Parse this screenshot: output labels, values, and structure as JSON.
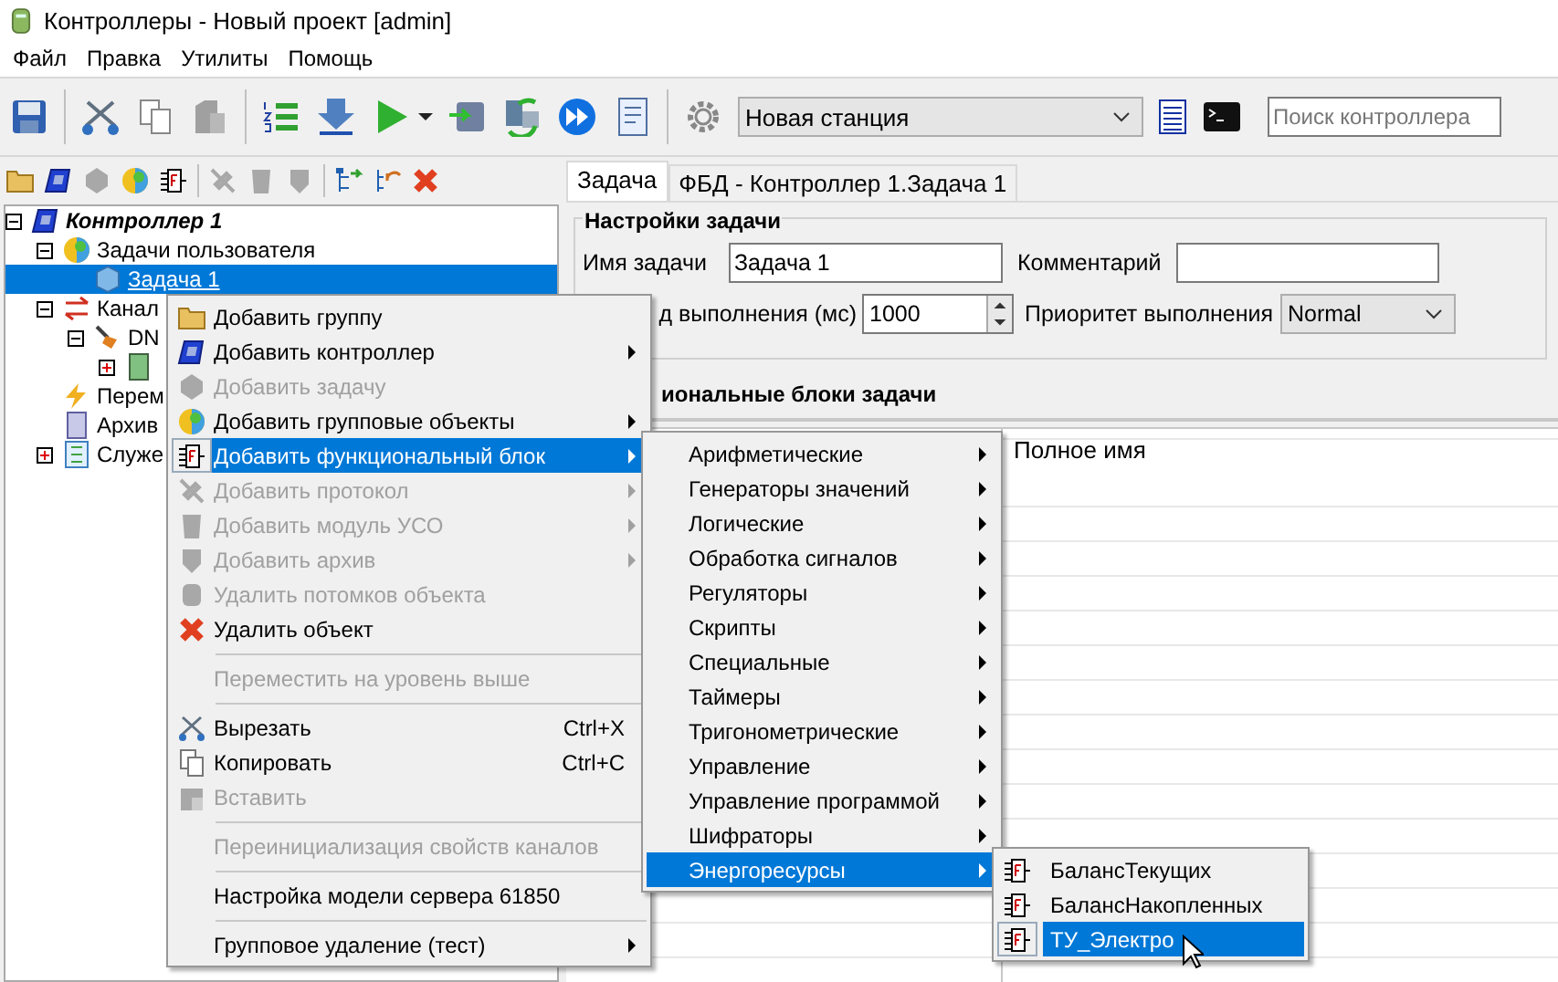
{
  "window": {
    "title": "Контроллеры - Новый проект [admin]"
  },
  "menu_bar": [
    "Файл",
    "Правка",
    "Утилиты",
    "Помощь"
  ],
  "toolbar": {
    "station": "Новая станция",
    "search": {
      "placeholder": "Поиск контроллера"
    }
  },
  "tree": [
    {
      "label": "Контроллер 1",
      "expanded": true,
      "selected": false,
      "children": [
        {
          "label": "Задачи пользователя",
          "expanded": true,
          "selected": false,
          "children": [
            {
              "label": "Задача 1",
              "selected": true
            }
          ]
        },
        {
          "label": "Канал",
          "expanded": true,
          "selected": false,
          "children": [
            {
              "label": "DN",
              "expanded": true,
              "selected": false,
              "children": [
                {
                  "expanded": false,
                  "selected": false
                }
              ]
            }
          ]
        },
        {
          "label": "Перем",
          "selected": false
        },
        {
          "label": "Архив",
          "selected": false
        },
        {
          "label": "Служе",
          "expanded": false,
          "selected": false
        }
      ]
    }
  ],
  "tabs": [
    {
      "label": "Задача",
      "selected": true
    },
    {
      "label": "ФБД - Контроллер 1.Задача 1",
      "selected": false
    }
  ],
  "settings": {
    "title": "Настройки задачи",
    "name_label": "Имя задачи",
    "name_value": "Задача 1",
    "comment_label": "Комментарий",
    "period_label": "д выполнения (мс)",
    "period_value": "1000",
    "priority_label": "Приоритет выполнения",
    "priority_value": "Normal"
  },
  "blocks": {
    "title": "иональные блоки задачи",
    "columns": [
      "Полное имя"
    ]
  },
  "context_menu": [
    {
      "kind": "item",
      "label": "Добавить группу",
      "disabled": false,
      "submenu": false,
      "selected": false
    },
    {
      "kind": "item",
      "label": "Добавить контроллер",
      "disabled": false,
      "submenu": true,
      "selected": false
    },
    {
      "kind": "item",
      "label": "Добавить задачу",
      "disabled": true,
      "submenu": false,
      "selected": false
    },
    {
      "kind": "item",
      "label": "Добавить групповые объекты",
      "disabled": false,
      "submenu": true,
      "selected": false
    },
    {
      "kind": "item",
      "label": "Добавить функциональный блок",
      "disabled": false,
      "submenu": true,
      "selected": true
    },
    {
      "kind": "item",
      "label": "Добавить протокол",
      "disabled": true,
      "submenu": true,
      "selected": false
    },
    {
      "kind": "item",
      "label": "Добавить модуль УСО",
      "disabled": true,
      "submenu": true,
      "selected": false
    },
    {
      "kind": "item",
      "label": "Добавить архив",
      "disabled": true,
      "submenu": true,
      "selected": false
    },
    {
      "kind": "item",
      "label": "Удалить потомков объекта",
      "disabled": true,
      "submenu": false,
      "selected": false
    },
    {
      "kind": "item",
      "label": "Удалить объект",
      "disabled": false,
      "submenu": false,
      "selected": false
    },
    {
      "kind": "separator"
    },
    {
      "kind": "item",
      "label": "Переместить на уровень выше",
      "disabled": true,
      "submenu": false,
      "selected": false
    },
    {
      "kind": "separator"
    },
    {
      "kind": "item",
      "label": "Вырезать",
      "shortcut": "Ctrl+X",
      "disabled": false,
      "submenu": false,
      "selected": false
    },
    {
      "kind": "item",
      "label": "Копировать",
      "shortcut": "Ctrl+C",
      "disabled": false,
      "submenu": false,
      "selected": false
    },
    {
      "kind": "item",
      "label": "Вставить",
      "disabled": true,
      "submenu": false,
      "selected": false
    },
    {
      "kind": "separator"
    },
    {
      "kind": "item",
      "label": "Переинициализация свойств каналов",
      "disabled": true,
      "submenu": false,
      "selected": false
    },
    {
      "kind": "separator"
    },
    {
      "kind": "item",
      "label": "Настройка модели сервера 61850",
      "disabled": false,
      "submenu": false,
      "selected": false
    },
    {
      "kind": "separator"
    },
    {
      "kind": "item",
      "label": "Групповое удаление (тест)",
      "disabled": false,
      "submenu": true,
      "selected": false
    }
  ],
  "block_menu": [
    {
      "label": "Арифметические",
      "selected": false
    },
    {
      "label": "Генераторы значений",
      "selected": false
    },
    {
      "label": "Логические",
      "selected": false
    },
    {
      "label": "Обработка сигналов",
      "selected": false
    },
    {
      "label": "Регуляторы",
      "selected": false
    },
    {
      "label": "Скрипты",
      "selected": false
    },
    {
      "label": "Специальные",
      "selected": false
    },
    {
      "label": "Таймеры",
      "selected": false
    },
    {
      "label": "Тригонометрические",
      "selected": false
    },
    {
      "label": "Управление",
      "selected": false
    },
    {
      "label": "Управление программой",
      "selected": false
    },
    {
      "label": "Шифраторы",
      "selected": false
    },
    {
      "label": "Энергоресурсы",
      "selected": true
    }
  ],
  "energy_menu": [
    {
      "label": "БалансТекущих",
      "selected": false
    },
    {
      "label": "БалансНакопленных",
      "selected": false
    },
    {
      "label": "ТУ_Электро",
      "selected": true
    }
  ]
}
